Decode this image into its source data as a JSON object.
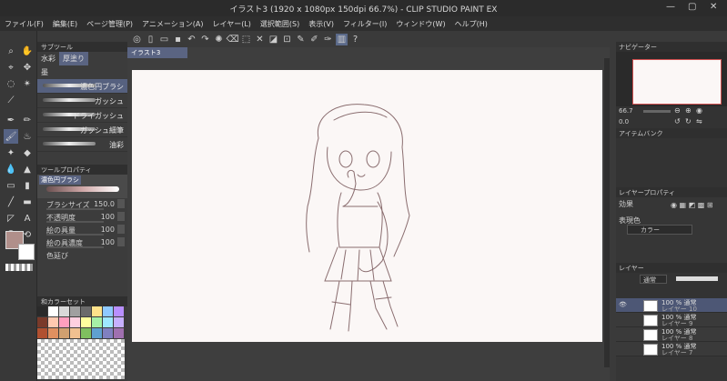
{
  "titlebar": {
    "title": "イラスト3 (1920 x 1080px 150dpi 66.7%)  -  CLIP STUDIO PAINT EX",
    "minimize": "—",
    "maximize": "▢",
    "close": "✕"
  },
  "menu": [
    "ファイル(F)",
    "編集(E)",
    "ページ管理(P)",
    "アニメーション(A)",
    "レイヤー(L)",
    "選択範囲(S)",
    "表示(V)",
    "フィルター(I)",
    "ウィンドウ(W)",
    "ヘルプ(H)"
  ],
  "document": {
    "tab": "イラスト3"
  },
  "subtool": {
    "header": "サブツール",
    "tabs": [
      "水彩",
      "厚塗り",
      "墨"
    ],
    "brushes": [
      "濃色円ブラシ",
      "ガッシュ",
      "ドライガッシュ",
      "ガッシュ細筆",
      "油彩"
    ]
  },
  "toolprop": {
    "header": "ツールプロパティ",
    "current": "濃色円ブラシ",
    "rows": [
      {
        "label": "ブラシサイズ",
        "value": "150.0"
      },
      {
        "label": "不透明度",
        "value": "100"
      },
      {
        "label": "絵の具量",
        "value": "100"
      },
      {
        "label": "絵の具濃度",
        "value": "100"
      },
      {
        "label": "色延び",
        "value": ""
      }
    ]
  },
  "colorset": {
    "header": "和カラーセット"
  },
  "navigator": {
    "header": "ナビゲーター",
    "zoom": "66.7",
    "angle": "0.0"
  },
  "item_bank": {
    "header": "アイテムバンク"
  },
  "layer_prop": {
    "header": "レイヤープロパティ",
    "effect": "効果",
    "color_label": "表現色",
    "color_value": "カラー"
  },
  "layers": {
    "header": "レイヤー",
    "blend": "通常",
    "items": [
      {
        "line1": "100 % 通常",
        "line2": "レイヤー 10"
      },
      {
        "line1": "100 % 通常",
        "line2": "レイヤー 9"
      },
      {
        "line1": "100 % 通常",
        "line2": "レイヤー 8"
      },
      {
        "line1": "100 % 通常",
        "line2": "レイヤー 7"
      }
    ]
  },
  "palette_colors": [
    "#2a2a2a",
    "#ffffff",
    "#d9d9d9",
    "#a0a0a0",
    "#6b6b6b",
    "#ffe28a",
    "#8fc9ff",
    "#b88fff",
    "#7a3a2a",
    "#ffc9b0",
    "#ff9fbf",
    "#ffd0e0",
    "#ffff9e",
    "#a6f0a6",
    "#9ee8ff",
    "#c6b0ff",
    "#b05030",
    "#e09060",
    "#d0a070",
    "#f0c090",
    "#7fbf5f",
    "#5fa0d0",
    "#8080c0",
    "#a070b0",
    "#603020",
    "#904020",
    "#c06040",
    "#d08050",
    "#407030",
    "#306090",
    "#404080",
    "#703070"
  ],
  "accent_color": "#5a6482"
}
